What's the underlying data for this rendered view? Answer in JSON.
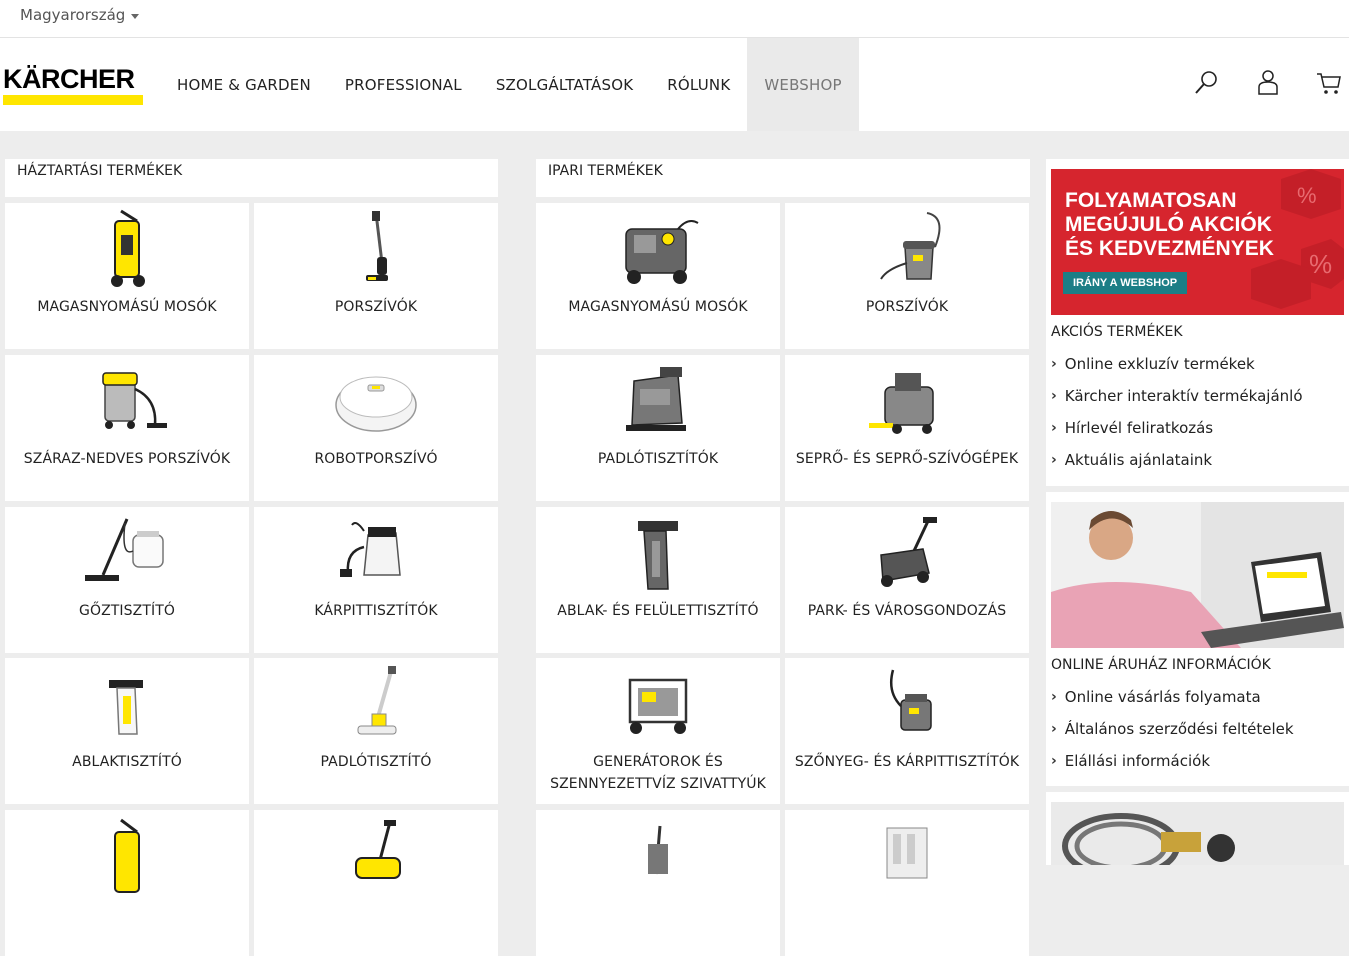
{
  "topbar": {
    "country": "Magyarország"
  },
  "header": {
    "logo_text": "KÄRCHER",
    "nav": [
      {
        "label": "HOME & GARDEN"
      },
      {
        "label": "PROFESSIONAL"
      },
      {
        "label": "SZOLGÁLTATÁSOK"
      },
      {
        "label": "RÓLUNK"
      },
      {
        "label": "WEBSHOP",
        "active": true
      }
    ],
    "icons": [
      "search-icon",
      "user-icon",
      "cart-icon"
    ]
  },
  "household": {
    "title": "HÁZTARTÁSI TERMÉKEK",
    "tiles": [
      {
        "label": "MAGASNYOMÁSÚ MOSÓK",
        "icon": "pressure-washer-image"
      },
      {
        "label": "PORSZÍVÓK",
        "icon": "stick-vacuum-image"
      },
      {
        "label": "SZÁRAZ-NEDVES PORSZÍVÓK",
        "icon": "wet-dry-vacuum-image"
      },
      {
        "label": "ROBOTPORSZÍVÓ",
        "icon": "robot-vacuum-image"
      },
      {
        "label": "GŐZTISZTÍTÓ",
        "icon": "steam-cleaner-image"
      },
      {
        "label": "KÁRPITTISZTÍTÓK",
        "icon": "upholstery-cleaner-image"
      },
      {
        "label": "ABLAKTISZTÍTÓ",
        "icon": "window-vac-image"
      },
      {
        "label": "PADLÓTISZTÍTÓ",
        "icon": "floor-cleaner-image"
      },
      {
        "label": "",
        "icon": "pressure-washer-image"
      },
      {
        "label": "",
        "icon": "lawn-mower-image"
      }
    ]
  },
  "industrial": {
    "title": "IPARI TERMÉKEK",
    "tiles": [
      {
        "label": "MAGASNYOMÁSÚ MOSÓK",
        "icon": "hot-water-washer-image"
      },
      {
        "label": "PORSZÍVÓK",
        "icon": "tub-vacuum-image"
      },
      {
        "label": "PADLÓTISZTÍTÓK",
        "icon": "scrubber-dryer-image"
      },
      {
        "label": "SEPRŐ- ÉS SEPRŐ-SZÍVÓGÉPEK",
        "icon": "sweeper-image"
      },
      {
        "label": "ABLAK- ÉS FELÜLETTISZTÍTÓ",
        "icon": "window-vac-pro-image"
      },
      {
        "label": "PARK- ÉS VÁROSGONDOZÁS",
        "icon": "lawn-mower-image"
      },
      {
        "label": "GENERÁTOROK ÉS SZENNYEZETTVÍZ SZIVATTYÚK",
        "icon": "generator-image"
      },
      {
        "label": "SZŐNYEG- ÉS KÁRPITTISZTÍTÓK",
        "icon": "carpet-cleaner-image"
      },
      {
        "label": "",
        "icon": "trolley-image"
      },
      {
        "label": "",
        "icon": "water-system-image"
      }
    ]
  },
  "sidebar": {
    "promo": {
      "title_lines": [
        "FOLYAMATOSAN",
        "MEGÚJULÓ AKCIÓK",
        "ÉS KEDVEZMÉNYEK"
      ],
      "button": "IRÁNY A WEBSHOP",
      "colors": {
        "bg": "#d6252e",
        "button": "#1c7e86"
      }
    },
    "sale_heading": "AKCIÓS TERMÉKEK",
    "sale_links": [
      "Online exkluzív termékek",
      "Kärcher interaktív termékajánló",
      "Hírlevél feliratkozás",
      "Aktuális ajánlataink"
    ],
    "shop_heading": "ONLINE ÁRUHÁZ INFORMÁCIÓK",
    "shop_links": [
      "Online vásárlás folyamata",
      "Általános szerződési feltételek",
      "Elállási információk"
    ]
  },
  "colors": {
    "brand_yellow": "#ffe600",
    "page_bg": "#ededed"
  }
}
